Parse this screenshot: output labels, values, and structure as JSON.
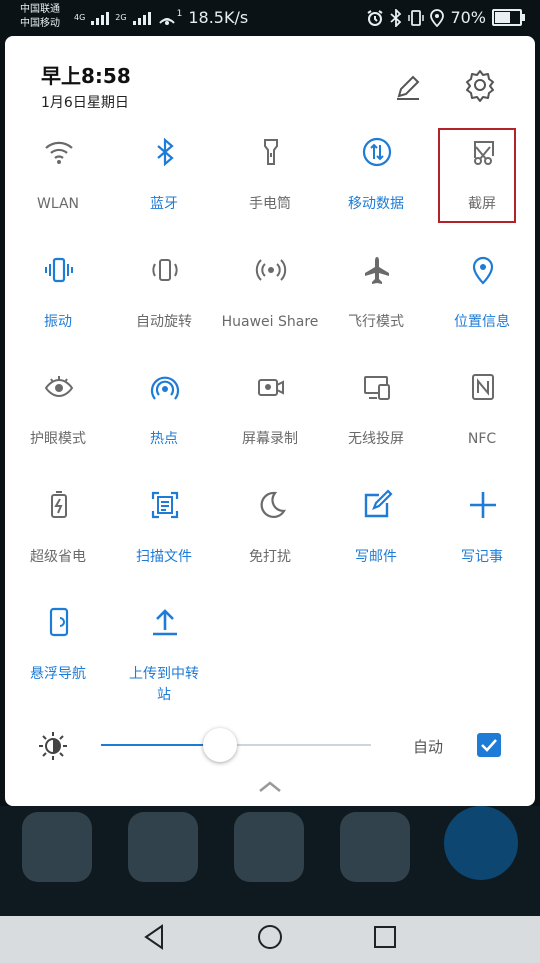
{
  "status_bar": {
    "carrier1": "中国联通",
    "carrier2": "中国移动",
    "net1": "4G",
    "net2": "2G",
    "hotspot_badge": "1",
    "speed": "18.5K/s",
    "battery": "70%",
    "battery_level": 0.7
  },
  "header": {
    "time": "早上8:58",
    "date": "1月6日星期日"
  },
  "tiles": [
    {
      "label": "WLAN",
      "icon": "wifi-icon",
      "on": false
    },
    {
      "label": "蓝牙",
      "icon": "bluetooth-icon",
      "on": true
    },
    {
      "label": "手电筒",
      "icon": "flashlight-icon",
      "on": false
    },
    {
      "label": "移动数据",
      "icon": "mobile-data-icon",
      "on": true
    },
    {
      "label": "截屏",
      "icon": "screenshot-icon",
      "on": false
    },
    {
      "label": "振动",
      "icon": "vibrate-icon",
      "on": true
    },
    {
      "label": "自动旋转",
      "icon": "auto-rotate-icon",
      "on": false
    },
    {
      "label": "Huawei Share",
      "icon": "huawei-share-icon",
      "on": false
    },
    {
      "label": "飞行模式",
      "icon": "airplane-icon",
      "on": false
    },
    {
      "label": "位置信息",
      "icon": "location-icon",
      "on": true
    },
    {
      "label": "护眼模式",
      "icon": "eye-icon",
      "on": false
    },
    {
      "label": "热点",
      "icon": "hotspot-icon",
      "on": true
    },
    {
      "label": "屏幕录制",
      "icon": "screen-record-icon",
      "on": false
    },
    {
      "label": "无线投屏",
      "icon": "wireless-projection-icon",
      "on": false
    },
    {
      "label": "NFC",
      "icon": "nfc-icon",
      "on": false
    },
    {
      "label": "超级省电",
      "icon": "power-saving-icon",
      "on": false
    },
    {
      "label": "扫描文件",
      "icon": "scan-document-icon",
      "on": true
    },
    {
      "label": "免打扰",
      "icon": "moon-icon",
      "on": false
    },
    {
      "label": "写邮件",
      "icon": "compose-email-icon",
      "on": true
    },
    {
      "label": "写记事",
      "icon": "add-note-icon",
      "on": true
    },
    {
      "label": "悬浮导航",
      "icon": "floating-nav-icon",
      "on": true
    },
    {
      "label": "上传到中转站",
      "icon": "upload-icon",
      "on": true
    }
  ],
  "brightness": {
    "level": 0.44,
    "auto_label": "自动",
    "auto_checked": true
  },
  "colors": {
    "accent": "#1e7bd6",
    "inactive": "#6a6a6a",
    "highlight_box": "#b3222a"
  }
}
